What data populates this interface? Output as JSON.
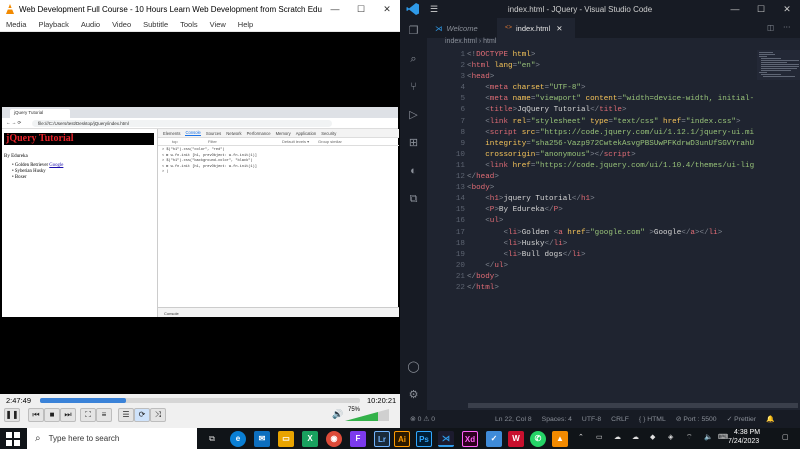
{
  "vlc": {
    "title": "Web Development Full Course - 10 Hours  Learn Web Development from Scratch  Edureka.mp4 -...",
    "menu": [
      "Media",
      "Playback",
      "Audio",
      "Video",
      "Subtitle",
      "Tools",
      "View",
      "Help"
    ],
    "time_elapsed": "2:47:49",
    "time_total": "10:20:21",
    "progress": 0.27,
    "volume": "75%"
  },
  "browser": {
    "tab_title": "jQuery Tutorial",
    "url": "file:///C:/Users/test/Desktop/jQuery/index.html",
    "page": {
      "h1": "jQuery Tutorial",
      "p": "By Edureka",
      "items": [
        {
          "before": "Golden Retriever ",
          "link": "Google"
        },
        {
          "before": "Syberian Husky",
          "link": ""
        },
        {
          "before": "Boxer",
          "link": ""
        }
      ]
    },
    "devtools": {
      "tabs": [
        "Elements",
        "Console",
        "Sources",
        "Network",
        "Performance",
        "Memory",
        "Application",
        "Security"
      ],
      "active_tab": "Console",
      "filter_top": "top",
      "filter_placeholder": "Filter",
      "default_levels": "Default levels ▾",
      "group_similar": "Group similar",
      "console_lines": [
        "> $(\"h1\").css(\"color\", \"red\")",
        "< ► w.fn.init [h1, prevObject: w.fn.init(1)]",
        "> $(\"h1\").css(\"background-color\", \"black\")",
        "< ► w.fn.init [h1, prevObject: w.fn.init(1)]",
        "> |"
      ],
      "drawer_label": "Console"
    }
  },
  "vscode": {
    "title": "index.html - JQuery - Visual Studio Code",
    "tabs": [
      {
        "label": "Welcome",
        "active": false
      },
      {
        "label": "index.html",
        "active": true
      }
    ],
    "breadcrumb": [
      "index.html",
      "html"
    ],
    "code_lines": [
      [
        [
          "p",
          "<!"
        ],
        [
          "t",
          "DOCTYPE"
        ],
        [
          "a",
          " html"
        ],
        [
          "p",
          ">"
        ]
      ],
      [
        [
          "p",
          "<"
        ],
        [
          "t",
          "html"
        ],
        [
          "a",
          " lang"
        ],
        [
          "p",
          "="
        ],
        [
          "s",
          "\"en\""
        ],
        [
          "p",
          ">"
        ]
      ],
      [
        [
          "p",
          "<"
        ],
        [
          "t",
          "head"
        ],
        [
          "p",
          ">"
        ]
      ],
      [
        [
          "d",
          "    "
        ],
        [
          "p",
          "<"
        ],
        [
          "t",
          "meta"
        ],
        [
          "a",
          " charset"
        ],
        [
          "p",
          "="
        ],
        [
          "s",
          "\"UTF-8\""
        ],
        [
          "p",
          ">"
        ]
      ],
      [
        [
          "d",
          "    "
        ],
        [
          "p",
          "<"
        ],
        [
          "t",
          "meta"
        ],
        [
          "a",
          " name"
        ],
        [
          "p",
          "="
        ],
        [
          "s",
          "\"viewport\""
        ],
        [
          "a",
          " content"
        ],
        [
          "p",
          "="
        ],
        [
          "s",
          "\"width=device-width, initial-"
        ]
      ],
      [
        [
          "d",
          "    "
        ],
        [
          "p",
          "<"
        ],
        [
          "t",
          "title"
        ],
        [
          "p",
          ">"
        ],
        [
          "d",
          "JqQuery Tutorial"
        ],
        [
          "p",
          "</"
        ],
        [
          "t",
          "title"
        ],
        [
          "p",
          ">"
        ]
      ],
      [
        [
          "d",
          "    "
        ],
        [
          "p",
          "<"
        ],
        [
          "t",
          "link"
        ],
        [
          "a",
          " rel"
        ],
        [
          "p",
          "="
        ],
        [
          "s",
          "\"stylesheet\""
        ],
        [
          "a",
          " type"
        ],
        [
          "p",
          "="
        ],
        [
          "s",
          "\"text/css\""
        ],
        [
          "a",
          " href"
        ],
        [
          "p",
          "="
        ],
        [
          "s",
          "\"index.css\""
        ],
        [
          "p",
          ">"
        ]
      ],
      [
        [
          "d",
          "    "
        ],
        [
          "p",
          "<"
        ],
        [
          "t",
          "script"
        ],
        [
          "a",
          " src"
        ],
        [
          "p",
          "="
        ],
        [
          "s",
          "\"https://code.jquery.com/ui/1.12.1/jquery-ui.mi"
        ]
      ],
      [
        [
          "d",
          "    "
        ],
        [
          "a",
          "integrity"
        ],
        [
          "p",
          "="
        ],
        [
          "s",
          "\"sha256-Vazp972CwtekAsvgPBSUwPFKdrwD3unUfSGVYrahU"
        ]
      ],
      [
        [
          "d",
          "    "
        ],
        [
          "a",
          "crossorigin"
        ],
        [
          "p",
          "="
        ],
        [
          "s",
          "\"anonymous\""
        ],
        [
          "p",
          "></"
        ],
        [
          "t",
          "script"
        ],
        [
          "p",
          ">"
        ]
      ],
      [
        [
          "d",
          "    "
        ],
        [
          "p",
          "<"
        ],
        [
          "t",
          "link"
        ],
        [
          "a",
          " href"
        ],
        [
          "p",
          "="
        ],
        [
          "s",
          "\"https://code.jquery.com/ui/1.10.4/themes/ui-lig"
        ]
      ],
      [
        [
          "p",
          "</"
        ],
        [
          "t",
          "head"
        ],
        [
          "p",
          ">"
        ]
      ],
      [
        [
          "p",
          "<"
        ],
        [
          "t",
          "body"
        ],
        [
          "p",
          ">"
        ]
      ],
      [
        [
          "d",
          "    "
        ],
        [
          "p",
          "<"
        ],
        [
          "t",
          "h1"
        ],
        [
          "p",
          ">"
        ],
        [
          "d",
          "jquery Tutorial"
        ],
        [
          "p",
          "</"
        ],
        [
          "t",
          "h1"
        ],
        [
          "p",
          ">"
        ]
      ],
      [
        [
          "d",
          "    "
        ],
        [
          "p",
          "<"
        ],
        [
          "t",
          "P"
        ],
        [
          "p",
          ">"
        ],
        [
          "d",
          "By Edureka"
        ],
        [
          "p",
          "</"
        ],
        [
          "t",
          "P"
        ],
        [
          "p",
          ">"
        ]
      ],
      [
        [
          "d",
          "    "
        ],
        [
          "p",
          "<"
        ],
        [
          "t",
          "ul"
        ],
        [
          "p",
          ">"
        ]
      ],
      [
        [
          "d",
          "        "
        ],
        [
          "p",
          "<"
        ],
        [
          "t",
          "li"
        ],
        [
          "p",
          ">"
        ],
        [
          "d",
          "Golden "
        ],
        [
          "p",
          "<"
        ],
        [
          "t",
          "a"
        ],
        [
          "a",
          " href"
        ],
        [
          "p",
          "="
        ],
        [
          "s",
          "\"google.com\""
        ],
        [
          "d",
          " "
        ],
        [
          "p",
          ">"
        ],
        [
          "d",
          "Google"
        ],
        [
          "p",
          "</"
        ],
        [
          "t",
          "a"
        ],
        [
          "p",
          "></"
        ],
        [
          "t",
          "li"
        ],
        [
          "p",
          ">"
        ]
      ],
      [
        [
          "d",
          "        "
        ],
        [
          "p",
          "<"
        ],
        [
          "t",
          "li"
        ],
        [
          "p",
          ">"
        ],
        [
          "d",
          "Husky"
        ],
        [
          "p",
          "</"
        ],
        [
          "t",
          "li"
        ],
        [
          "p",
          ">"
        ]
      ],
      [
        [
          "d",
          "        "
        ],
        [
          "p",
          "<"
        ],
        [
          "t",
          "li"
        ],
        [
          "p",
          ">"
        ],
        [
          "d",
          "Bull dogs"
        ],
        [
          "p",
          "</"
        ],
        [
          "t",
          "li"
        ],
        [
          "p",
          ">"
        ]
      ],
      [
        [
          "d",
          "    "
        ],
        [
          "p",
          "</"
        ],
        [
          "t",
          "ul"
        ],
        [
          "p",
          ">"
        ]
      ],
      [
        [
          "p",
          "</"
        ],
        [
          "t",
          "body"
        ],
        [
          "p",
          ">"
        ]
      ],
      [
        [
          "p",
          "</"
        ],
        [
          "t",
          "html"
        ],
        [
          "p",
          ">"
        ]
      ]
    ],
    "status": {
      "errors": "⊗ 0 ⚠ 0",
      "position": "Ln 22, Col 8",
      "spaces": "Spaces: 4",
      "encoding": "UTF-8",
      "eol": "CRLF",
      "language": "{ } HTML",
      "port": "⊘ Port : 5500",
      "prettier": "✓ Prettier"
    }
  },
  "taskbar": {
    "search_placeholder": "Type here to search",
    "apps": [
      "Ps",
      "Xd",
      "Lr",
      "Ai"
    ],
    "time": "4:38 PM",
    "date": "7/24/2023"
  },
  "colors": {
    "vscode_bg": "#1f2430",
    "vlc_progress": "#3a82d8",
    "h1_text": "#e8222a",
    "h1_bg": "#000000"
  }
}
